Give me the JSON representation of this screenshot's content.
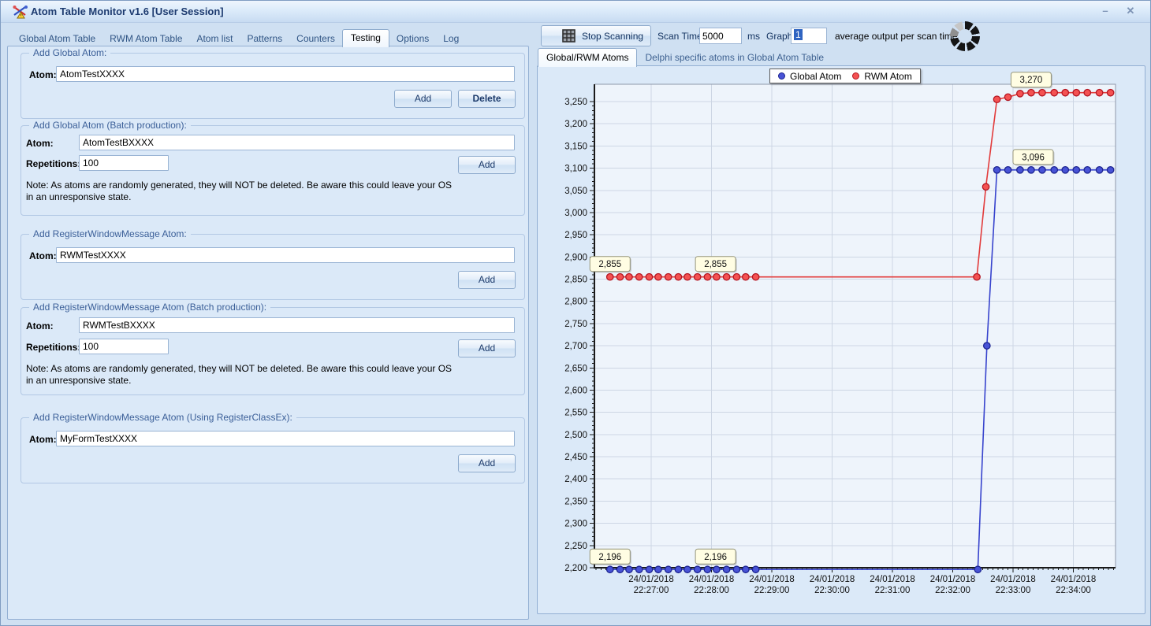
{
  "window": {
    "title": "Atom Table Monitor v1.6 [User Session]",
    "minimize": "–",
    "close": "✕"
  },
  "left_tabs": {
    "items": [
      {
        "label": "Global Atom Table",
        "active": false
      },
      {
        "label": "RWM Atom Table",
        "active": false
      },
      {
        "label": "Atom list",
        "active": false
      },
      {
        "label": "Patterns",
        "active": false
      },
      {
        "label": "Counters",
        "active": false
      },
      {
        "label": "Testing",
        "active": true
      },
      {
        "label": "Options",
        "active": false
      },
      {
        "label": "Log",
        "active": false
      }
    ]
  },
  "testing": {
    "group1": {
      "title": "Add Global Atom:",
      "atom_label": "Atom:",
      "atom_value": "AtomTestXXXX",
      "add_label": "Add",
      "delete_label": "Delete"
    },
    "group2": {
      "title": "Add Global Atom (Batch production):",
      "atom_label": "Atom:",
      "atom_value": "AtomTestBXXXX",
      "rep_label": "Repetitions:",
      "rep_value": "100",
      "add_label": "Add",
      "note_line1": "Note: As atoms are randomly generated, they will NOT be deleted. Be aware this could leave your OS",
      "note_line2": "in an unresponsive state."
    },
    "group3": {
      "title": "Add RegisterWindowMessage Atom:",
      "atom_label": "Atom:",
      "atom_value": "RWMTestXXXX",
      "add_label": "Add"
    },
    "group4": {
      "title": "Add RegisterWindowMessage Atom (Batch production):",
      "atom_label": "Atom:",
      "atom_value": "RWMTestBXXXX",
      "rep_label": "Repetitions:",
      "rep_value": "100",
      "add_label": "Add",
      "note_line1": "Note: As atoms are randomly generated, they will NOT be deleted. Be aware this could leave your OS",
      "note_line2": "in an unresponsive state."
    },
    "group5": {
      "title": "Add RegisterWindowMessage Atom (Using RegisterClassEx):",
      "atom_label": "Atom:",
      "atom_value": "MyFormTestXXXX",
      "add_label": "Add"
    }
  },
  "scan": {
    "stop_button": "Stop Scanning",
    "scan_time_label": "Scan Time:",
    "scan_time_value": "5000",
    "ms_label": "ms",
    "graph_label": "Graph:",
    "graph_value": "1",
    "avg_text": "average output per scan time"
  },
  "right_tabs": {
    "items": [
      {
        "label": "Global/RWM Atoms",
        "active": true
      },
      {
        "label": "Delphi specific atoms in Global Atom Table",
        "active": false
      }
    ]
  },
  "chart_data": {
    "type": "line",
    "title": "",
    "x_axis": {
      "range_s": [
        3.5,
        522
      ],
      "ticks": [
        {
          "t": 60,
          "date": "24/01/2018",
          "time": "22:27:00"
        },
        {
          "t": 120,
          "date": "24/01/2018",
          "time": "22:28:00"
        },
        {
          "t": 180,
          "date": "24/01/2018",
          "time": "22:29:00"
        },
        {
          "t": 240,
          "date": "24/01/2018",
          "time": "22:30:00"
        },
        {
          "t": 300,
          "date": "24/01/2018",
          "time": "22:31:00"
        },
        {
          "t": 360,
          "date": "24/01/2018",
          "time": "22:32:00"
        },
        {
          "t": 420,
          "date": "24/01/2018",
          "time": "22:33:00"
        },
        {
          "t": 480,
          "date": "24/01/2018",
          "time": "22:34:00"
        }
      ]
    },
    "y_axis": {
      "min": 2200,
      "max": 3250,
      "step": 50,
      "minor_step": 10
    },
    "grid": true,
    "legend_position": "top",
    "series": [
      {
        "name": "Global Atom",
        "line_color": "#3743cd",
        "dot_fill": "#4853d6",
        "dot_stroke": "#1c2490",
        "points": [
          [
            19,
            2196
          ],
          [
            29,
            2196
          ],
          [
            38,
            2196
          ],
          [
            48,
            2196
          ],
          [
            58,
            2196
          ],
          [
            67,
            2196
          ],
          [
            77,
            2196
          ],
          [
            87,
            2196
          ],
          [
            96,
            2196
          ],
          [
            106,
            2196
          ],
          [
            116,
            2196
          ],
          [
            125,
            2196
          ],
          [
            135,
            2196
          ],
          [
            145,
            2196
          ],
          [
            154,
            2196
          ],
          [
            164,
            2196
          ],
          [
            385,
            2196
          ],
          [
            394,
            2700
          ],
          [
            404,
            3096
          ],
          [
            415,
            3096
          ],
          [
            427,
            3096
          ],
          [
            438,
            3096
          ],
          [
            449,
            3096
          ],
          [
            461,
            3096
          ],
          [
            472,
            3096
          ],
          [
            483,
            3096
          ],
          [
            494,
            3096
          ],
          [
            506,
            3096
          ],
          [
            517,
            3096
          ]
        ]
      },
      {
        "name": "RWM Atom",
        "line_color": "#e23b3b",
        "dot_fill": "#f45252",
        "dot_stroke": "#b41622",
        "points": [
          [
            19,
            2855
          ],
          [
            29,
            2855
          ],
          [
            38,
            2855
          ],
          [
            48,
            2855
          ],
          [
            58,
            2855
          ],
          [
            67,
            2855
          ],
          [
            77,
            2855
          ],
          [
            87,
            2855
          ],
          [
            96,
            2855
          ],
          [
            106,
            2855
          ],
          [
            116,
            2855
          ],
          [
            125,
            2855
          ],
          [
            135,
            2855
          ],
          [
            145,
            2855
          ],
          [
            154,
            2855
          ],
          [
            164,
            2855
          ],
          [
            384,
            2855
          ],
          [
            393,
            3058
          ],
          [
            404,
            3255
          ],
          [
            415,
            3260
          ],
          [
            427,
            3268
          ],
          [
            438,
            3270
          ],
          [
            449,
            3270
          ],
          [
            461,
            3270
          ],
          [
            472,
            3270
          ],
          [
            483,
            3270
          ],
          [
            494,
            3270
          ],
          [
            506,
            3270
          ],
          [
            517,
            3270
          ]
        ]
      }
    ],
    "annotations": [
      {
        "text": "2,855",
        "t": 19,
        "v": 2855
      },
      {
        "text": "2,855",
        "t": 124,
        "v": 2855
      },
      {
        "text": "2,196",
        "t": 19,
        "v": 2196
      },
      {
        "text": "2,196",
        "t": 124,
        "v": 2196
      },
      {
        "text": "3,270",
        "t": 438,
        "v": 3270
      },
      {
        "text": "3,096",
        "t": 440,
        "v": 3096
      }
    ],
    "colors": {
      "plot_bg": "#eef4fb",
      "grid": "#cdd6e4",
      "axis": "#1a1a1a",
      "border": "#8f98a8",
      "annotation_bg": "#fffde3",
      "annotation_border": "#95957a"
    }
  }
}
